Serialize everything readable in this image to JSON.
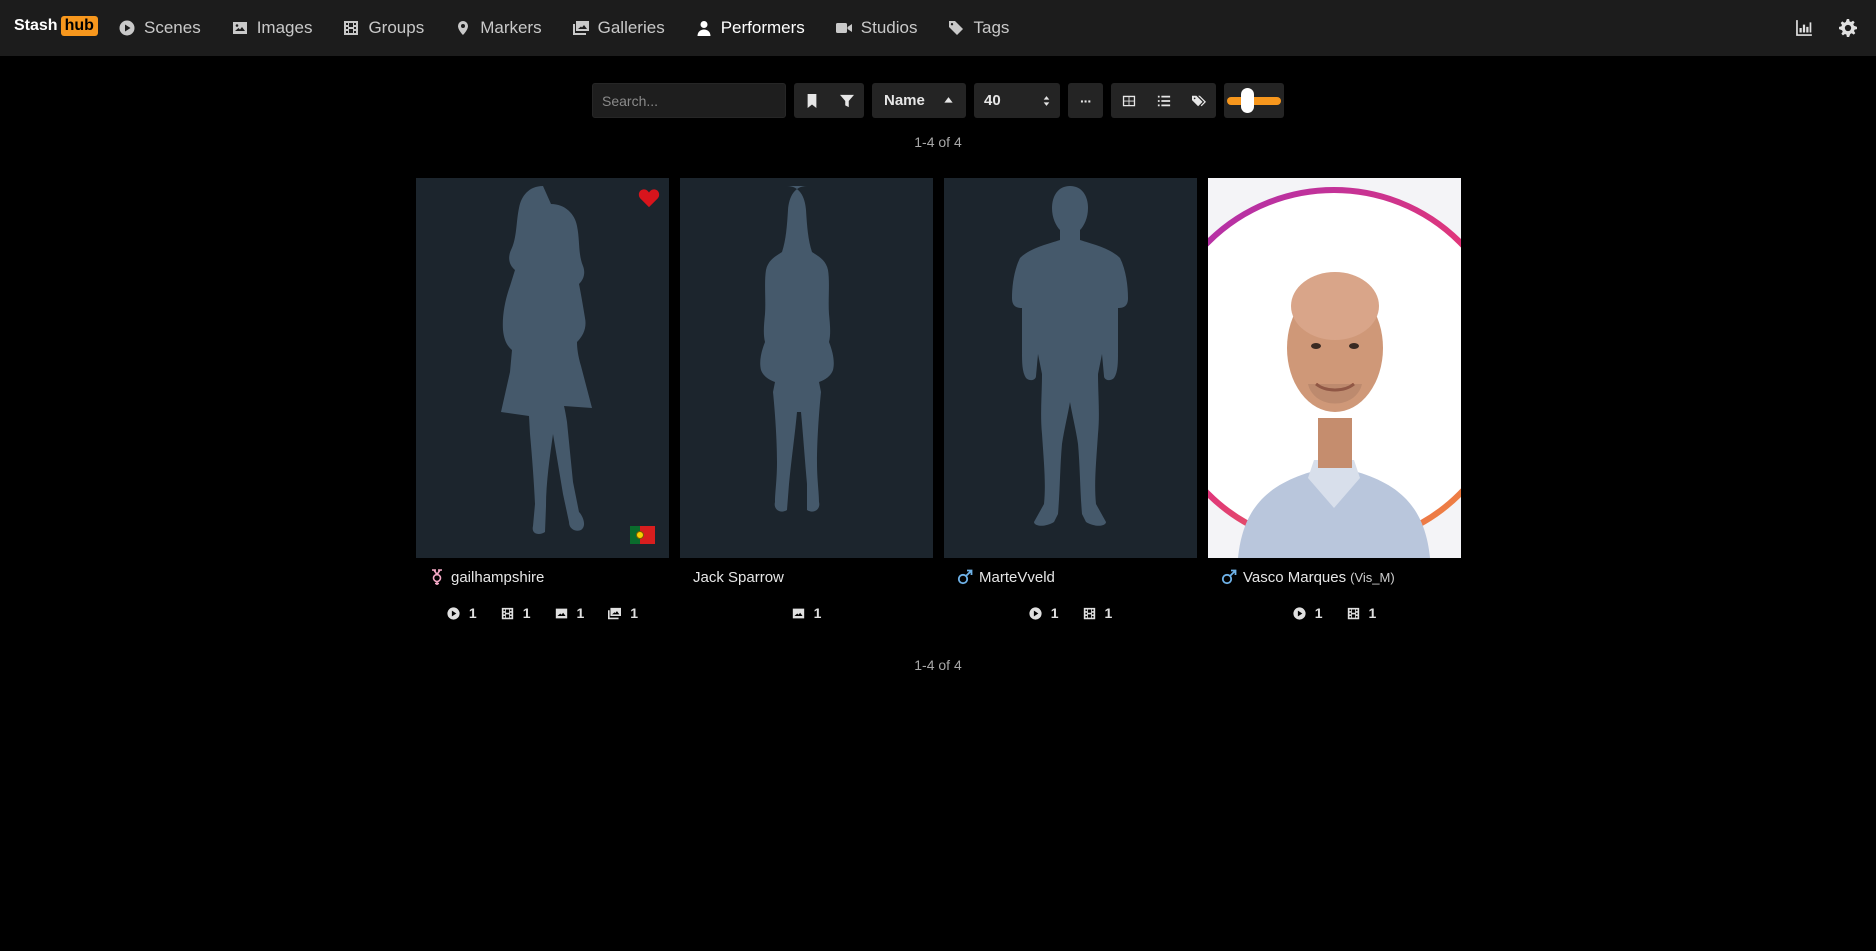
{
  "brand": {
    "text": "Stash",
    "hub": "hub"
  },
  "nav": [
    {
      "label": "Scenes",
      "icon": "play-circle-icon"
    },
    {
      "label": "Images",
      "icon": "image-icon"
    },
    {
      "label": "Groups",
      "icon": "film-icon"
    },
    {
      "label": "Markers",
      "icon": "map-marker-icon"
    },
    {
      "label": "Galleries",
      "icon": "images-icon"
    },
    {
      "label": "Performers",
      "icon": "user-icon",
      "active": true
    },
    {
      "label": "Studios",
      "icon": "video-icon"
    },
    {
      "label": "Tags",
      "icon": "tag-icon"
    }
  ],
  "nav_right": [
    "chart-icon",
    "gear-icon"
  ],
  "toolbar": {
    "search_placeholder": "Search...",
    "sort_by": "Name",
    "per_page": "40",
    "more_label": "···",
    "zoom_level": 0.35
  },
  "pagination": {
    "top": "1-4 of 4",
    "bottom": "1-4 of 4"
  },
  "accent_color": "#f7971d",
  "performers": [
    {
      "name": "gailhampshire",
      "disambiguation": "",
      "gender_icon": "transgender-icon",
      "favorite": true,
      "flag": "Portugal",
      "image": "female-silhouette",
      "stats": [
        {
          "icon": "play-circle-icon",
          "count": "1"
        },
        {
          "icon": "film-icon",
          "count": "1"
        },
        {
          "icon": "image-icon",
          "count": "1"
        },
        {
          "icon": "images-icon",
          "count": "1"
        }
      ]
    },
    {
      "name": "Jack Sparrow",
      "disambiguation": "",
      "gender_icon": "",
      "favorite": false,
      "image": "female-silhouette-2",
      "stats": [
        {
          "icon": "image-icon",
          "count": "1"
        }
      ]
    },
    {
      "name": "MarteVveld",
      "disambiguation": "",
      "gender_icon": "mars-icon",
      "favorite": false,
      "image": "male-silhouette",
      "stats": [
        {
          "icon": "play-circle-icon",
          "count": "1"
        },
        {
          "icon": "film-icon",
          "count": "1"
        }
      ]
    },
    {
      "name": "Vasco Marques",
      "disambiguation": "(Vis_M)",
      "gender_icon": "mars-icon",
      "favorite": false,
      "image": "photo",
      "stats": [
        {
          "icon": "play-circle-icon",
          "count": "1"
        },
        {
          "icon": "film-icon",
          "count": "1"
        }
      ]
    }
  ]
}
